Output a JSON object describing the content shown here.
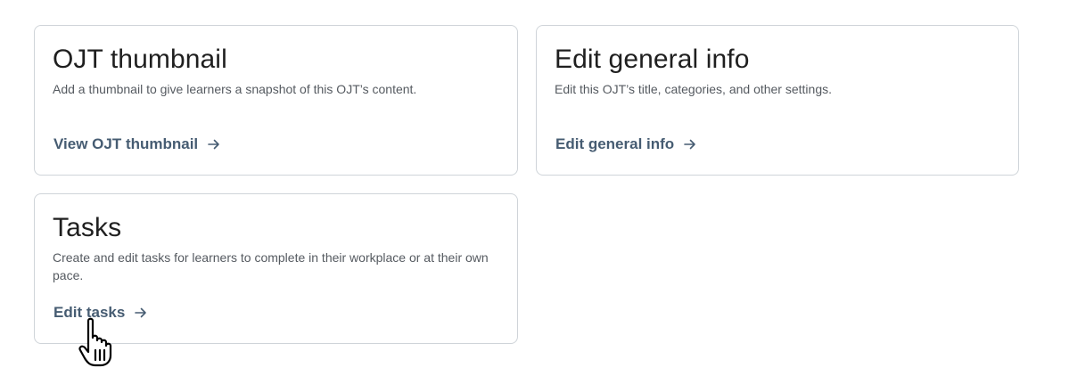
{
  "cards": [
    {
      "title": "OJT thumbnail",
      "description": "Add a thumbnail to give learners a snapshot of this OJT’s content.",
      "link_label": "View OJT thumbnail"
    },
    {
      "title": "Edit general info",
      "description": "Edit this OJT’s title, categories, and other settings.",
      "link_label": "Edit general info"
    },
    {
      "title": "Tasks",
      "description": "Create and edit tasks for learners to complete in their workplace or at their own pace.",
      "link_label": "Edit tasks"
    }
  ],
  "icons": {
    "link_arrow": "arrow-right-icon",
    "cursor": "hand-pointer-cursor-icon"
  },
  "colors": {
    "link": "#465c72",
    "border": "#cfd4d9",
    "title": "#1f1f1f",
    "description": "#555a60"
  }
}
